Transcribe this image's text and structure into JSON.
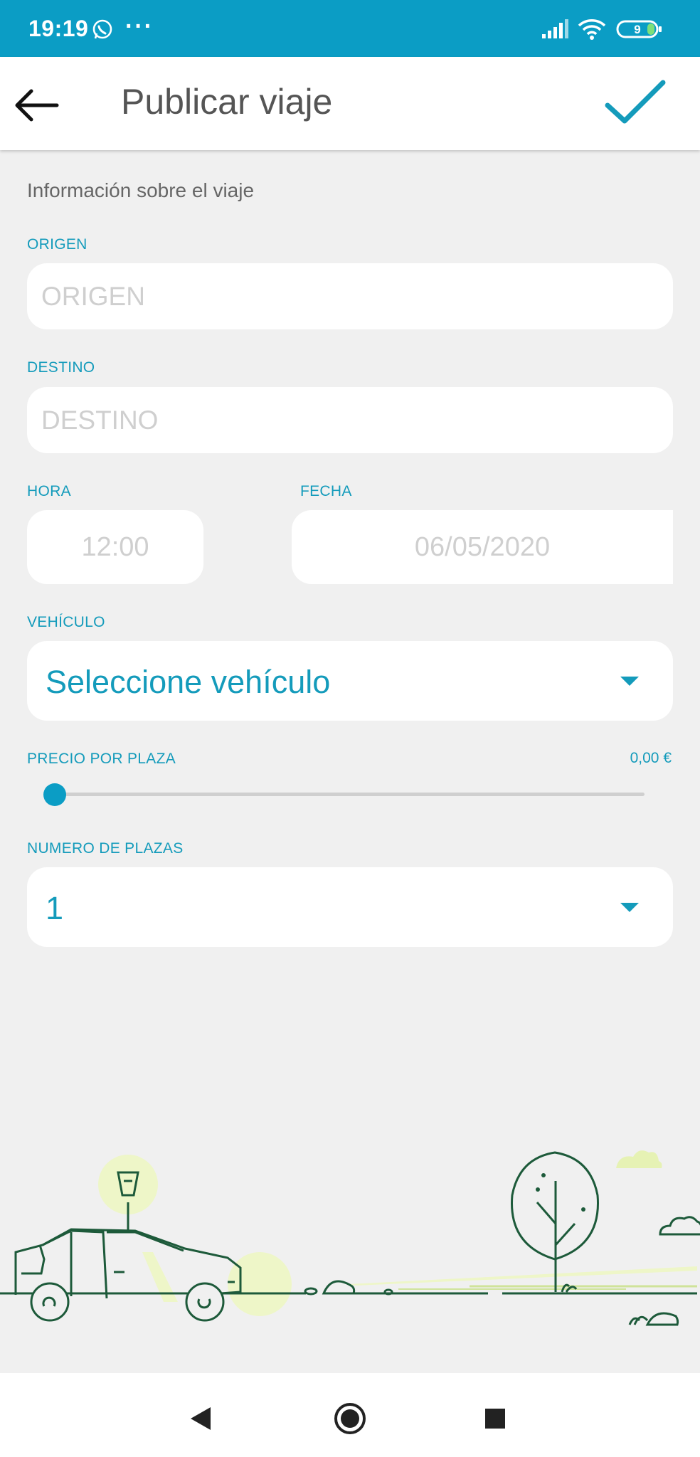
{
  "status_bar": {
    "time": "19:19",
    "notification_icon": "whatsapp-icon",
    "more": "···",
    "battery": "9"
  },
  "app_bar": {
    "title": "Publicar viaje",
    "back_icon": "arrow-left-icon",
    "confirm_icon": "check-icon"
  },
  "form": {
    "section_title": "Información sobre el viaje",
    "origin": {
      "label": "ORIGEN",
      "placeholder": "ORIGEN"
    },
    "destination": {
      "label": "DESTINO",
      "placeholder": "DESTINO"
    },
    "time": {
      "label": "HORA",
      "value": "12:00"
    },
    "date": {
      "label": "FECHA",
      "value": "06/05/2020"
    },
    "vehicle": {
      "label": "VEHÍCULO",
      "selected": "Seleccione vehículo"
    },
    "price": {
      "label": "PRECIO POR PLAZA",
      "value": "0,00 €",
      "slider_fraction": 0
    },
    "seats": {
      "label": "NUMERO DE PLAZAS",
      "selected": "1"
    }
  },
  "colors": {
    "primary": "#0b9dc5",
    "label": "#149bbb",
    "background": "#f0f0f0",
    "illustration_stroke": "#1d5a3a",
    "illustration_accent": "#e9f3b7"
  },
  "nav_bar": {
    "back": "triangle-back-icon",
    "home": "circle-home-icon",
    "recents": "square-recents-icon"
  }
}
